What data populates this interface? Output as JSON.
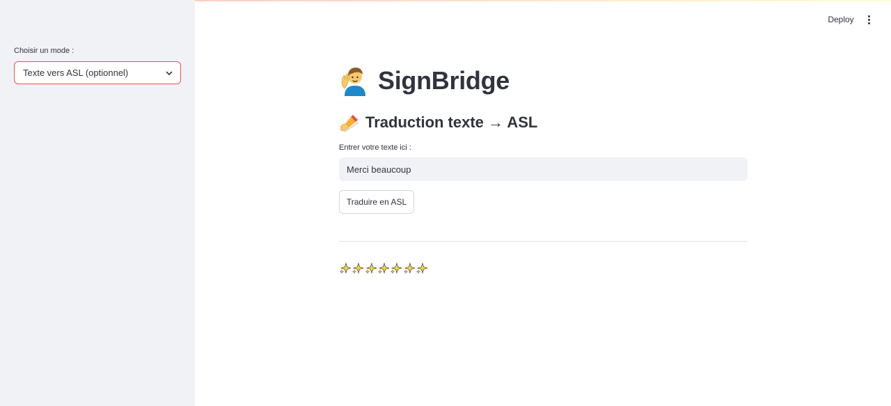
{
  "sidebar": {
    "mode_label": "Choisir un mode :",
    "mode_selected": "Texte vers ASL (optionnel)"
  },
  "header": {
    "deploy_label": "Deploy",
    "menu_icon": "more-vertical-icon"
  },
  "main": {
    "title": "SignBridge",
    "title_icon": "person-signing-icon",
    "subtitle": "Traduction texte → ASL",
    "subtitle_icon": "writing-hand-icon",
    "input_label": "Entrer votre texte ici :",
    "input_value": "Merci beaucoup",
    "button_label": "Traduire en ASL",
    "sparkle_icon": "sparkle-icon",
    "sparkle_count": 7
  },
  "colors": {
    "accent": "#ff4b4b",
    "sidebar_bg": "#f0f2f6",
    "text": "#31333f",
    "sparkle": "#fdd835"
  }
}
